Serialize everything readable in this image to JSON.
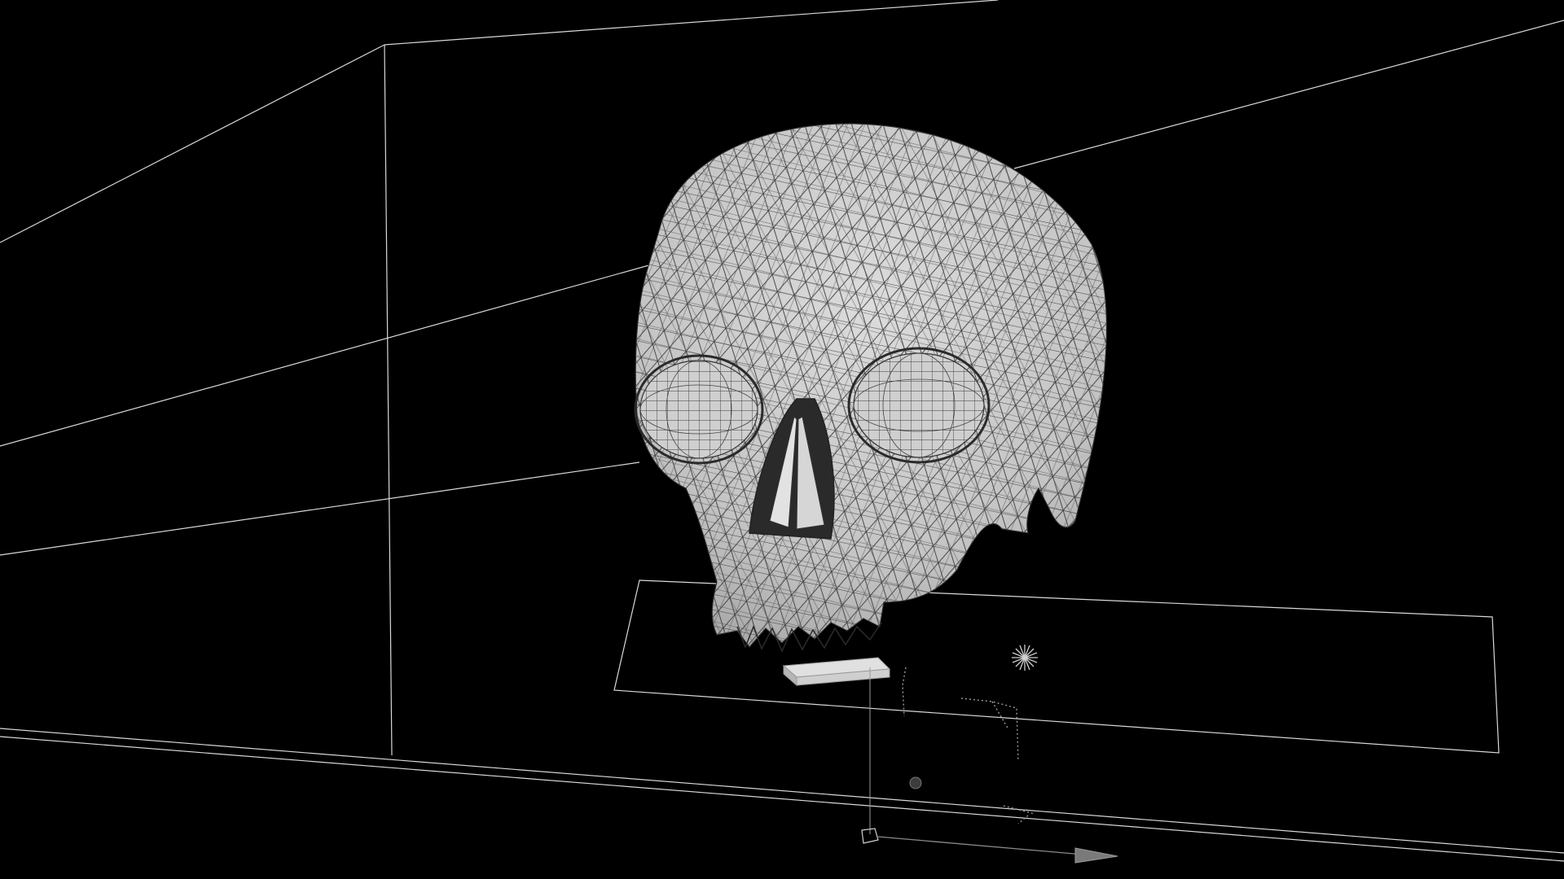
{
  "viewport": {
    "background_color": "#000000",
    "wireframe_color": "#d9d9d9",
    "mesh_fill_color": "#c9c9c9",
    "mesh_line_color": "#3a3a3a"
  },
  "scene_objects": [
    {
      "name": "skull-mesh",
      "icon": "skull-mesh"
    },
    {
      "name": "nose-bone",
      "icon": "nose-mesh"
    },
    {
      "name": "left-eye-sphere",
      "icon": "sphere-mesh"
    },
    {
      "name": "right-eye-sphere",
      "icon": "sphere-mesh"
    },
    {
      "name": "ground-plane",
      "icon": "plane-outline"
    },
    {
      "name": "backdrop-cube",
      "icon": "cube-outline"
    },
    {
      "name": "chin-block",
      "icon": "box-mesh"
    },
    {
      "name": "point-light",
      "icon": "star-light-icon"
    },
    {
      "name": "camera-target",
      "icon": "target-dot-icon"
    },
    {
      "name": "transform-gizmo",
      "icon": "move-arrow-icon"
    }
  ]
}
